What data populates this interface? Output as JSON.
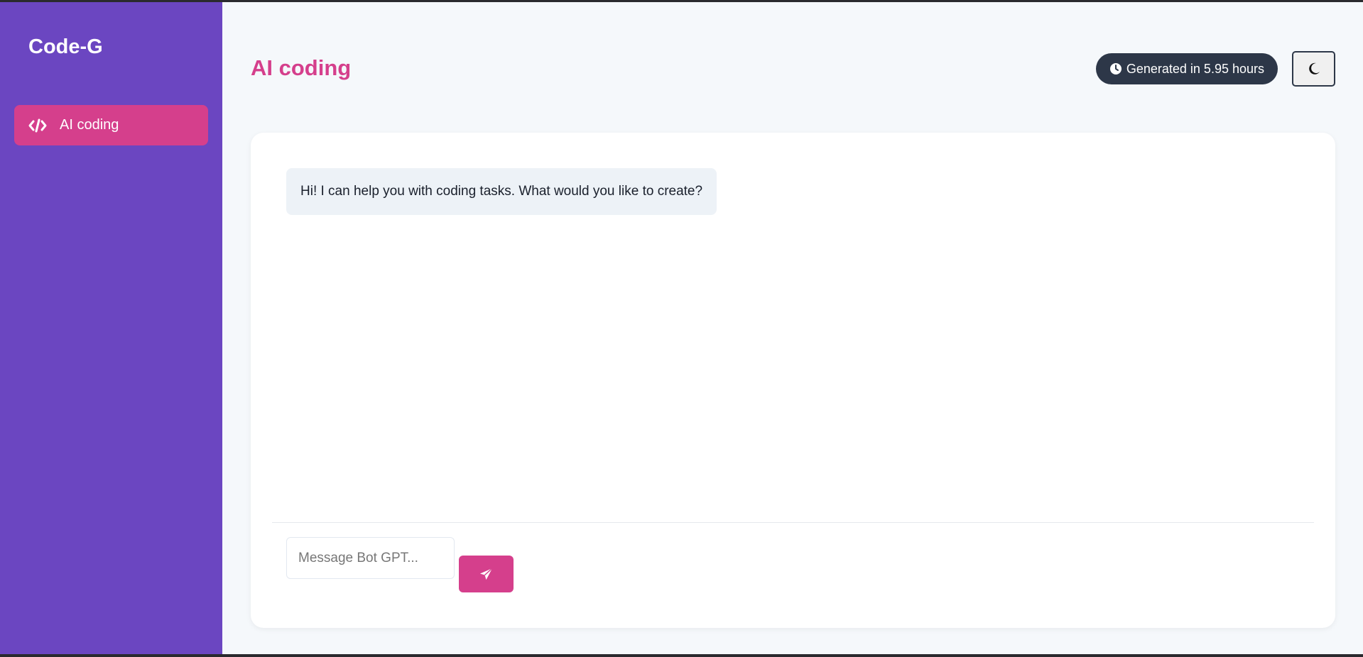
{
  "sidebar": {
    "brand": "Code-G",
    "items": [
      {
        "label": "AI coding",
        "icon": "code-icon",
        "active": true
      }
    ]
  },
  "header": {
    "title": "AI coding",
    "generated_badge": "Generated in 5.95 hours",
    "badge_icon": "clock-icon",
    "theme_toggle_icon": "moon-icon"
  },
  "chat": {
    "messages": [
      {
        "role": "bot",
        "text": "Hi! I can help you with coding tasks. What would you like to create?"
      }
    ],
    "input_placeholder": "Message Bot GPT...",
    "input_value": "",
    "send_icon": "paper-plane-icon"
  },
  "colors": {
    "sidebar": "#6b46c1",
    "accent": "#d53f8c",
    "badge": "#2d3748",
    "background": "#f5f8fb"
  }
}
